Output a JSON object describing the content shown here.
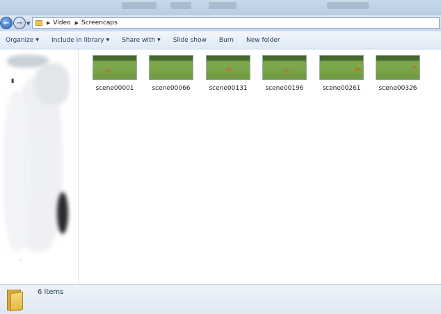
{
  "address_bar": {
    "breadcrumbs": [
      "Video",
      "Screencaps"
    ]
  },
  "toolbar": {
    "organize_label": "Organize",
    "include_label": "Include in library",
    "share_label": "Share with",
    "slideshow_label": "Slide show",
    "burn_label": "Burn",
    "new_folder_label": "New folder"
  },
  "files": [
    {
      "name": "scene00001"
    },
    {
      "name": "scene00066"
    },
    {
      "name": "scene00131"
    },
    {
      "name": "scene00196"
    },
    {
      "name": "scene00261"
    },
    {
      "name": "scene00326"
    }
  ],
  "status": {
    "item_count": "6 items"
  },
  "colors": {
    "toolbar_text": "#1e395b",
    "folder": "#e4b843"
  },
  "icons": [
    "back-arrow-icon",
    "forward-arrow-icon",
    "folder-icon",
    "dropdown-arrow-icon"
  ]
}
